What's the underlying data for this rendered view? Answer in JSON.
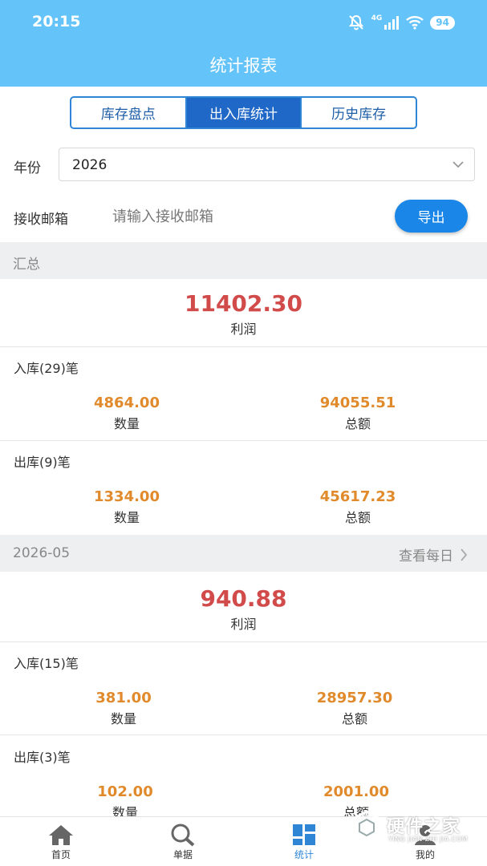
{
  "status_bar": {
    "time": "20:15",
    "network": "4G",
    "battery": "94"
  },
  "header": {
    "title": "统计报表"
  },
  "tabs": [
    {
      "label": "库存盘点",
      "active": false
    },
    {
      "label": "出入库统计",
      "active": true
    },
    {
      "label": "历史库存",
      "active": false
    }
  ],
  "form": {
    "year_label": "年份",
    "year_value": "2026",
    "email_label": "接收邮箱",
    "email_placeholder": "请输入接收邮箱",
    "export_label": "导出"
  },
  "summary": {
    "section_title": "汇总",
    "profit_value": "11402.30",
    "profit_label": "利润",
    "inbound_title": "入库(29)笔",
    "inbound_qty": "4864.00",
    "inbound_amount": "94055.51",
    "outbound_title": "出库(9)笔",
    "outbound_qty": "1334.00",
    "outbound_amount": "45617.23",
    "qty_label": "数量",
    "amount_label": "总额"
  },
  "month": {
    "section_title": "2026-05",
    "link_label": "查看每日",
    "profit_value": "940.88",
    "profit_label": "利润",
    "inbound_title": "入库(15)笔",
    "inbound_qty": "381.00",
    "inbound_amount": "28957.30",
    "outbound_title": "出库(3)笔",
    "outbound_qty": "102.00",
    "outbound_amount": "2001.00",
    "qty_label": "数量",
    "amount_label": "总额"
  },
  "bottom_nav": [
    {
      "label": "首页",
      "icon": "home-icon"
    },
    {
      "label": "单据",
      "icon": "search-icon"
    },
    {
      "label": "统计",
      "icon": "grid-icon",
      "active": true
    },
    {
      "label": "我的",
      "icon": "user-icon"
    }
  ],
  "watermark": {
    "text": "硬件之家",
    "sub": "YING JIAN ZHI JIA.COM"
  },
  "colors": {
    "header": "#64c3f8",
    "tab_active": "#2068c8",
    "profit": "#d24b4b",
    "stat": "#e08a2c",
    "export": "#1a86e8"
  }
}
